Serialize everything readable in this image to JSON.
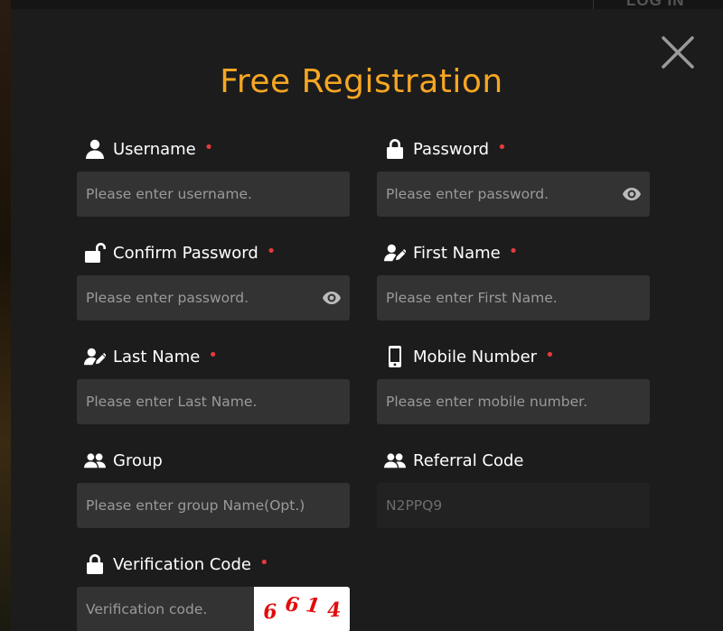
{
  "background": {
    "login_text": "LOG IN"
  },
  "modal": {
    "title": "Free Registration",
    "close_icon": "close-icon"
  },
  "fields": {
    "username": {
      "label": "Username",
      "placeholder": "Please enter username.",
      "required": "•",
      "icon": "user-icon"
    },
    "password": {
      "label": "Password",
      "placeholder": "Please enter password.",
      "required": "•",
      "icon": "lock-icon",
      "toggle_icon": "eye-icon"
    },
    "confirm_password": {
      "label": "Confirm Password",
      "placeholder": "Please enter password.",
      "required": "•",
      "icon": "unlock-icon",
      "toggle_icon": "eye-icon"
    },
    "first_name": {
      "label": "First Name",
      "placeholder": "Please enter First Name.",
      "required": "•",
      "icon": "user-edit-icon"
    },
    "last_name": {
      "label": "Last Name",
      "placeholder": "Please enter Last Name.",
      "required": "•",
      "icon": "user-edit-icon"
    },
    "mobile": {
      "label": "Mobile Number",
      "placeholder": "Please enter mobile number.",
      "required": "•",
      "icon": "mobile-phone-icon"
    },
    "group": {
      "label": "Group",
      "placeholder": "Please enter group Name(Opt.)",
      "icon": "users-icon"
    },
    "referral": {
      "label": "Referral Code",
      "value": "N2PPQ9",
      "icon": "users-icon"
    },
    "verification": {
      "label": "Verification Code",
      "placeholder": "Verification code.",
      "required": "•",
      "icon": "lock-icon",
      "captcha_digits": [
        "6",
        "6",
        "1",
        "4"
      ]
    }
  },
  "colors": {
    "title": "#f5a623",
    "required_dot": "#e23b3b",
    "input_bg": "#333333",
    "modal_bg": "#1c1c1c",
    "captcha_text": "#e20c0c"
  }
}
